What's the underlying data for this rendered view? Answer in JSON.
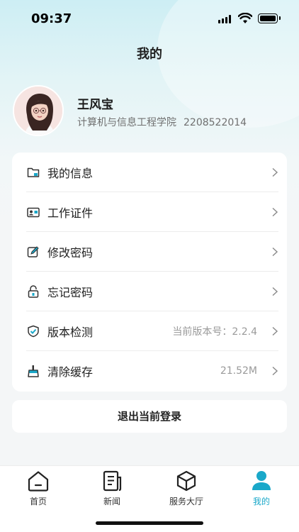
{
  "status_bar": {
    "time": "09:37"
  },
  "header": {
    "title": "我的"
  },
  "profile": {
    "name": "王风宝",
    "college": "计算机与信息工程学院",
    "student_id": "2208522014"
  },
  "menu": {
    "items": [
      {
        "label": "我的信息",
        "value": "",
        "icon": "folder-icon"
      },
      {
        "label": "工作证件",
        "value": "",
        "icon": "id-card-icon"
      },
      {
        "label": "修改密码",
        "value": "",
        "icon": "edit-icon"
      },
      {
        "label": "忘记密码",
        "value": "",
        "icon": "lock-icon"
      },
      {
        "label": "版本检测",
        "value": "当前版本号：2.2.4",
        "icon": "shield-icon"
      },
      {
        "label": "清除缓存",
        "value": "21.52M",
        "icon": "broom-icon"
      }
    ]
  },
  "logout": {
    "label": "退出当前登录"
  },
  "tabbar": {
    "tabs": [
      {
        "label": "首页",
        "icon": "home-icon"
      },
      {
        "label": "新闻",
        "icon": "news-icon"
      },
      {
        "label": "服务大厅",
        "icon": "cube-icon"
      },
      {
        "label": "我的",
        "icon": "user-icon"
      }
    ],
    "active": "我的"
  },
  "colors": {
    "accent": "#1aa8c9",
    "background": "#f4f6f7"
  }
}
